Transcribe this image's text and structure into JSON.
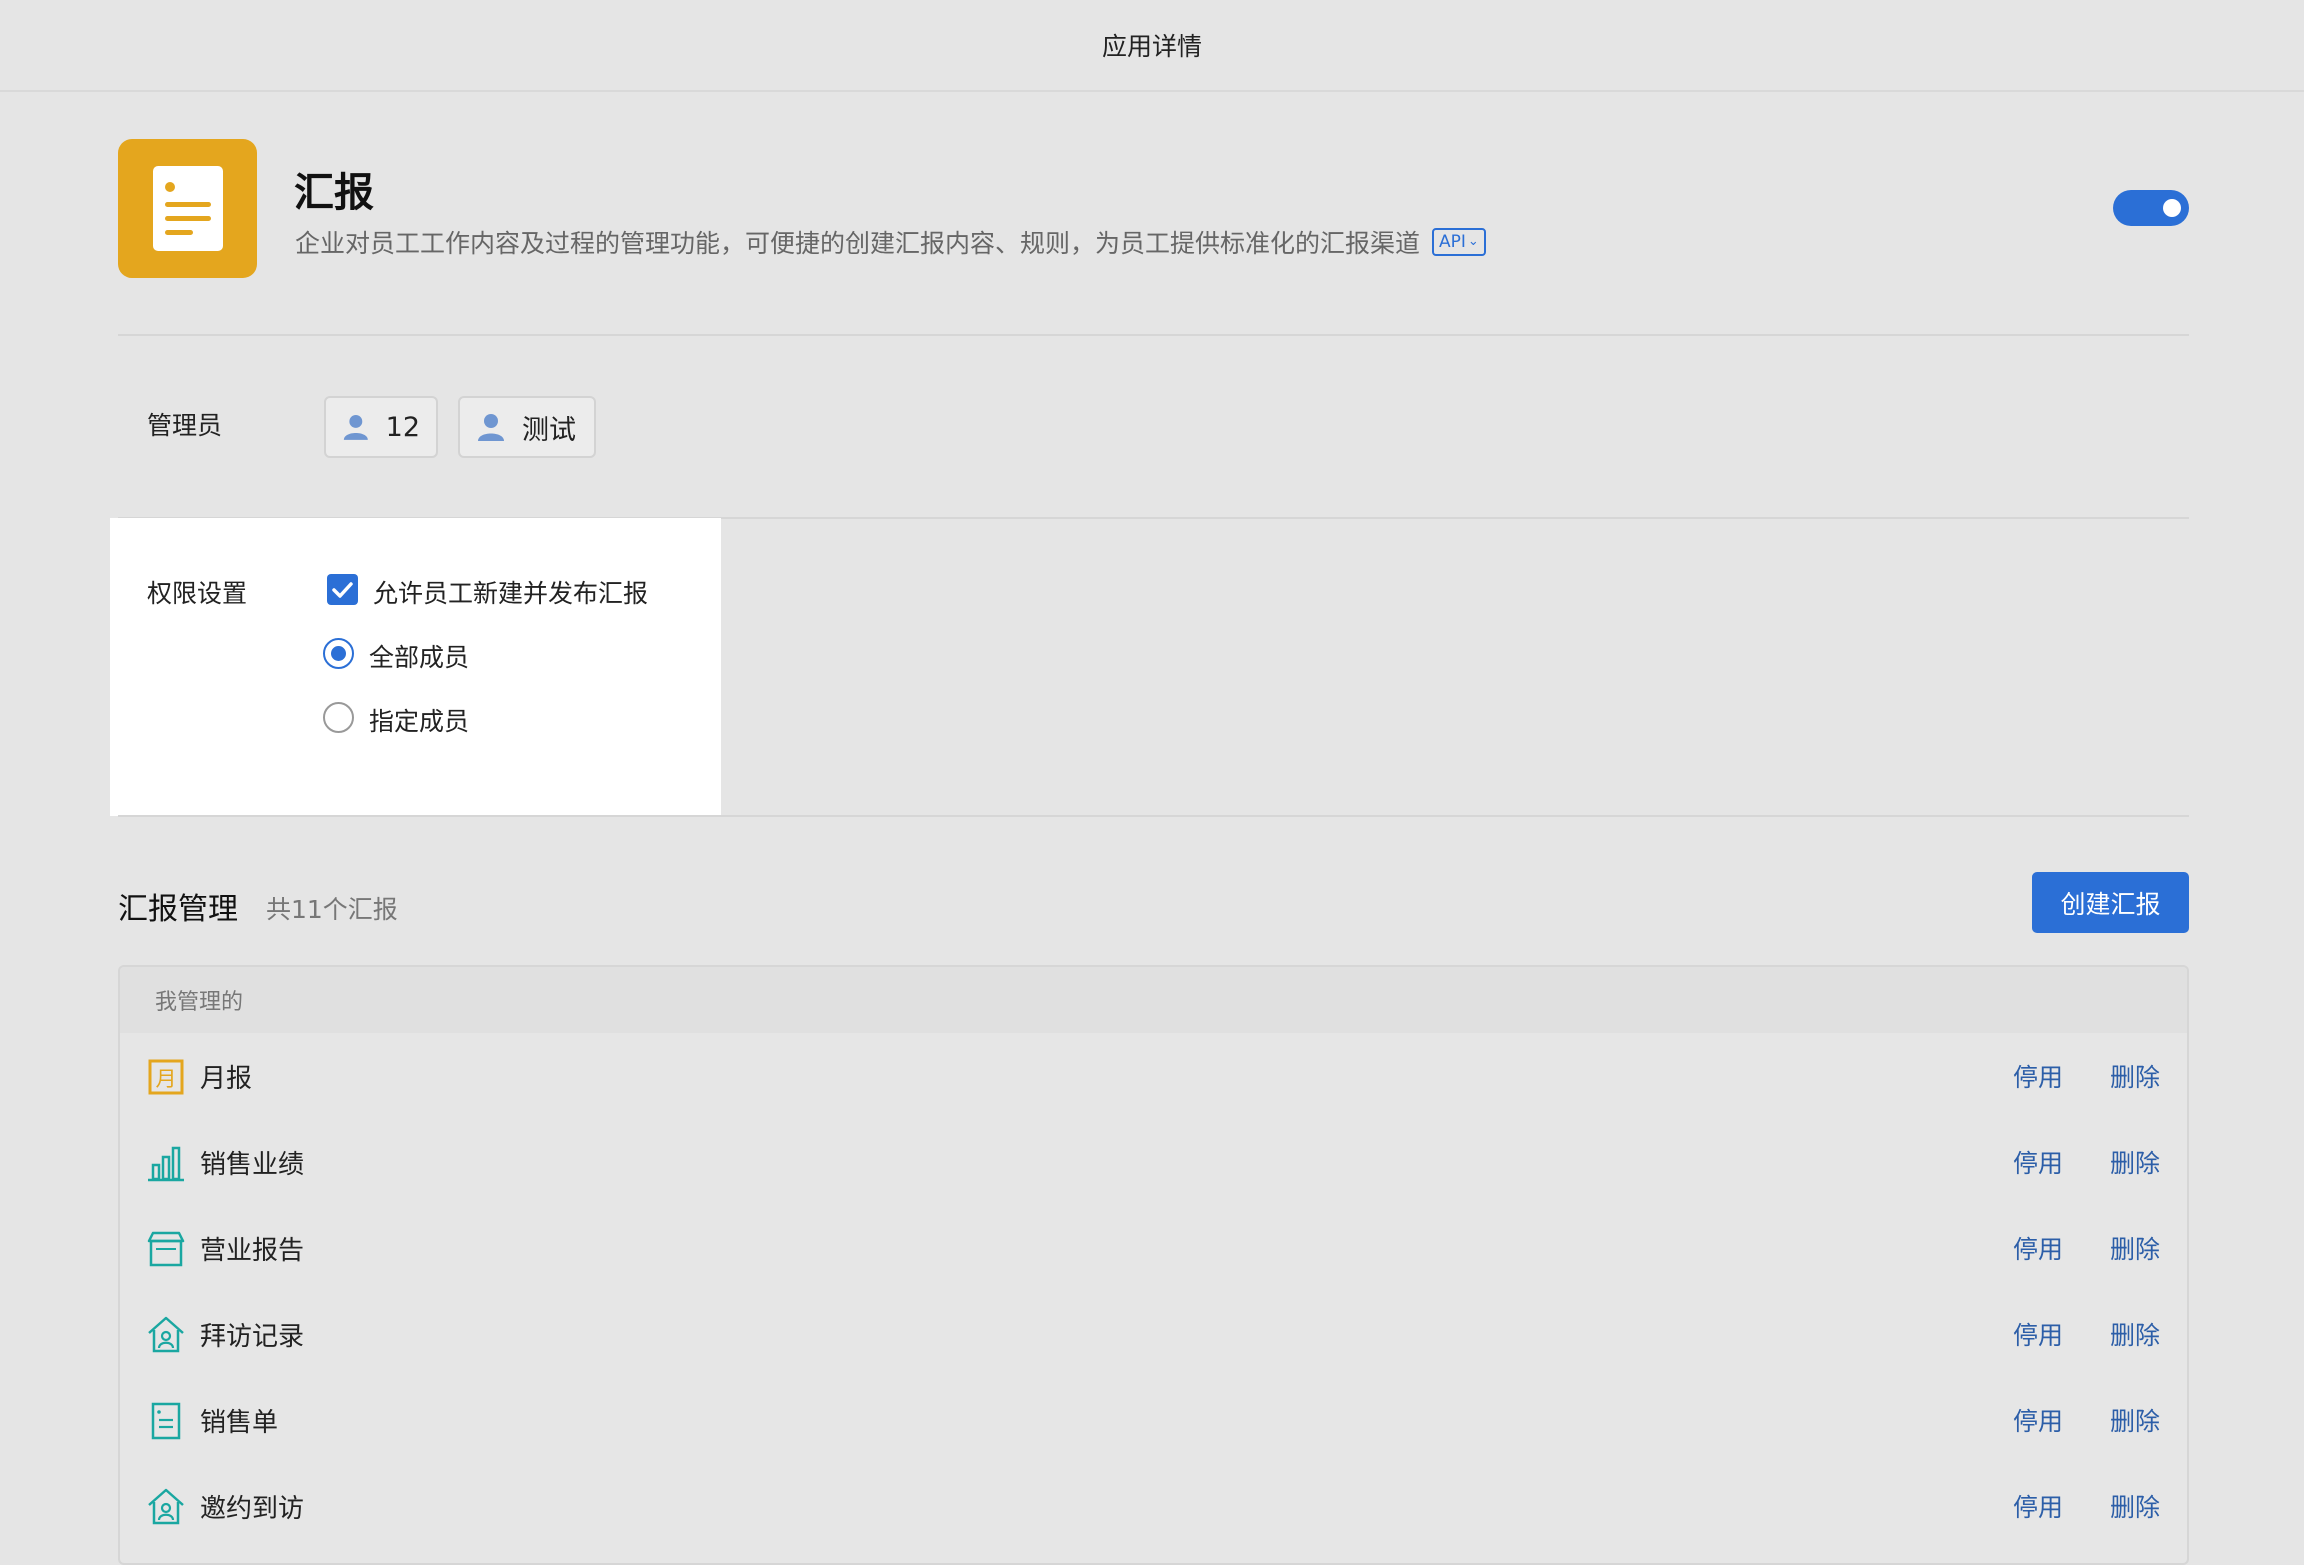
{
  "window": {
    "title": "应用详情"
  },
  "app": {
    "name": "汇报",
    "description": "企业对员工工作内容及过程的管理功能，可便捷的创建汇报内容、规则，为员工提供标准化的汇报渠道",
    "api_badge": "API",
    "enabled": true,
    "icon": "report-doc-icon",
    "icon_color": "#e4a61e"
  },
  "admins": {
    "label": "管理员",
    "members": [
      {
        "name": "12",
        "icon": "person-icon"
      },
      {
        "name": "测试",
        "icon": "person-icon"
      }
    ]
  },
  "permissions": {
    "label": "权限设置",
    "allow_create": {
      "label": "允许员工新建并发布汇报",
      "checked": true
    },
    "options": [
      {
        "label": "全部成员",
        "selected": true
      },
      {
        "label": "指定成员",
        "selected": false
      }
    ]
  },
  "management": {
    "title": "汇报管理",
    "count_text": "共11个汇报",
    "create_label": "创建汇报",
    "group_header": "我管理的",
    "disable_label": "停用",
    "delete_label": "删除",
    "reports": [
      {
        "name": "月报",
        "icon": "month-calendar-icon",
        "color": "#e4a61e"
      },
      {
        "name": "销售业绩",
        "icon": "bar-chart-icon",
        "color": "#1aa7a1"
      },
      {
        "name": "营业报告",
        "icon": "store-icon",
        "color": "#1aa7a1"
      },
      {
        "name": "拜访记录",
        "icon": "house-person-icon",
        "color": "#1aa7a1"
      },
      {
        "name": "销售单",
        "icon": "document-list-icon",
        "color": "#1aa7a1"
      },
      {
        "name": "邀约到访",
        "icon": "house-person-icon",
        "color": "#1aa7a1"
      }
    ]
  },
  "colors": {
    "accent": "#2b6fd6",
    "link": "#2c5ea8",
    "background": "#e5e5e5"
  }
}
